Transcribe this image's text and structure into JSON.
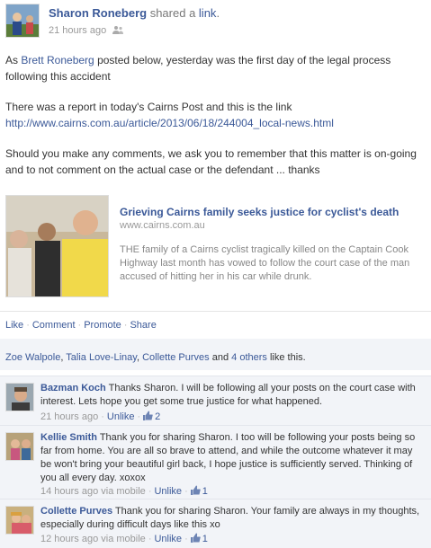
{
  "post": {
    "author": "Sharon Roneberg",
    "action_text": "shared a",
    "action_link": "link",
    "action_period": ".",
    "timestamp": "21 hours ago",
    "audience_icon": "friends-icon",
    "body": {
      "mention": "Brett Roneberg",
      "line1_prefix": "As ",
      "line1_suffix": " posted below, yesterday was the first day of the legal process following this accident",
      "line2": "There was a report in today's Cairns Post and this is the link",
      "url": "http://www.cairns.com.au/article/2013/06/18/244004_local-news.html",
      "line3": "Should you make any comments, we ask you to remember that this matter is on-going and to not comment on the actual case or the defendant ... thanks"
    }
  },
  "attachment": {
    "title": "Grieving Cairns family seeks justice for cyclist's death",
    "domain": "www.cairns.com.au",
    "description": "THE family of a Cairns cyclist tragically killed on the Captain Cook Highway last month has vowed to follow the court case of the man accused of hitting her in his car while drunk."
  },
  "actions": {
    "like": "Like",
    "comment": "Comment",
    "promote": "Promote",
    "share": "Share",
    "separator": "·"
  },
  "likes": {
    "names": [
      "Zoe Walpole",
      "Talia Love-Linay",
      "Collette Purves"
    ],
    "and_text": "and",
    "others": "4 others",
    "suffix": "like this."
  },
  "comments": [
    {
      "author": "Bazman Koch",
      "text": "Thanks Sharon. I will be following all your posts on the court case with interest. Lets hope you get some true justice for what happened.",
      "timestamp": "21 hours ago",
      "via": "",
      "unlike": "Unlike",
      "like_count": "2"
    },
    {
      "author": "Kellie Smith",
      "text": "Thank you for sharing Sharon. I too will be following your posts being so far from home. You are all so brave to attend, and while the outcome whatever it may be won't bring your beautiful girl back, I hope justice is sufficiently served. Thinking of you all every day. xoxox",
      "timestamp": "14 hours ago",
      "via": "via mobile",
      "unlike": "Unlike",
      "like_count": "1"
    },
    {
      "author": "Collette Purves",
      "text": "Thank you for sharing Sharon. Your family are always in my thoughts, especially during difficult days like this xo",
      "timestamp": "12 hours ago",
      "via": "via mobile",
      "unlike": "Unlike",
      "like_count": "1"
    }
  ],
  "colors": {
    "link": "#3b5998",
    "meta": "#999999",
    "comment_bg": "#f2f4f8"
  }
}
